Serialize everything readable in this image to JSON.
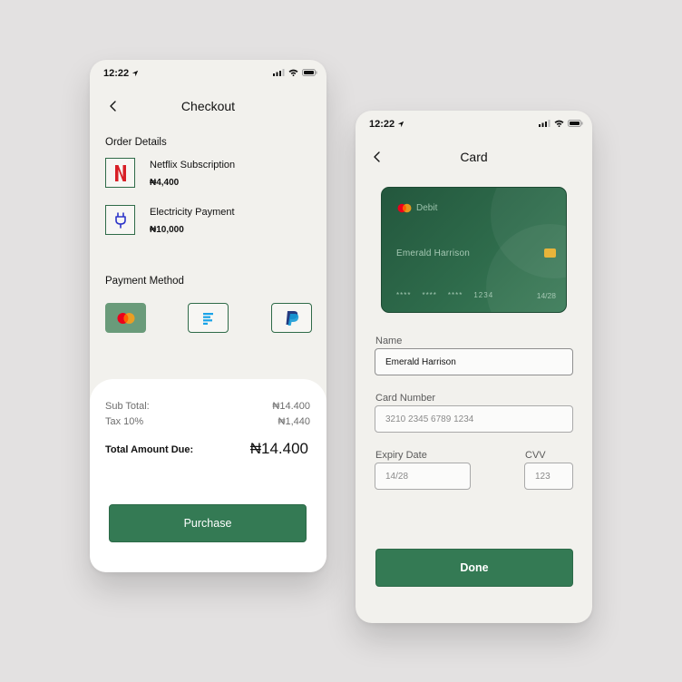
{
  "colors": {
    "background": "#e3e1e1",
    "screen": "#f2f1ed",
    "accent": "#347a54",
    "card": "#2e6b4b"
  },
  "checkout_screen": {
    "status_time": "12:22",
    "title": "Checkout",
    "order_details_title": "Order Details",
    "items": [
      {
        "icon": "netflix-icon",
        "name": "Netflix Subscription",
        "price": "₦4,400"
      },
      {
        "icon": "plug-icon",
        "name": "Electricity Payment",
        "price": "₦10,000"
      }
    ],
    "payment_method_title": "Payment Method",
    "payment_methods": [
      {
        "icon": "mastercard-icon",
        "selected": true
      },
      {
        "icon": "bank-app-icon",
        "selected": false
      },
      {
        "icon": "paypal-icon",
        "selected": false
      }
    ],
    "summary": {
      "subtotal_label": "Sub Total:",
      "subtotal_value": "₦14.400",
      "tax_label": "Tax 10%",
      "tax_value": "₦1,440",
      "total_label": "Total Amount Due:",
      "total_value": "₦14.400"
    },
    "purchase_label": "Purchase"
  },
  "card_screen": {
    "status_time": "12:22",
    "title": "Card",
    "card": {
      "type": "Debit",
      "holder": "Emerald Harrison",
      "digit_groups": [
        "****",
        "****",
        "****",
        "1234"
      ],
      "expiry": "14/28"
    },
    "name_label": "Name",
    "name_value": "Emerald Harrison",
    "card_number_label": "Card Number",
    "card_number_placeholder": "3210 2345 6789 1234",
    "expiry_label": "Expiry Date",
    "expiry_placeholder": "14/28",
    "cvv_label": "CVV",
    "cvv_placeholder": "123",
    "done_label": "Done"
  }
}
